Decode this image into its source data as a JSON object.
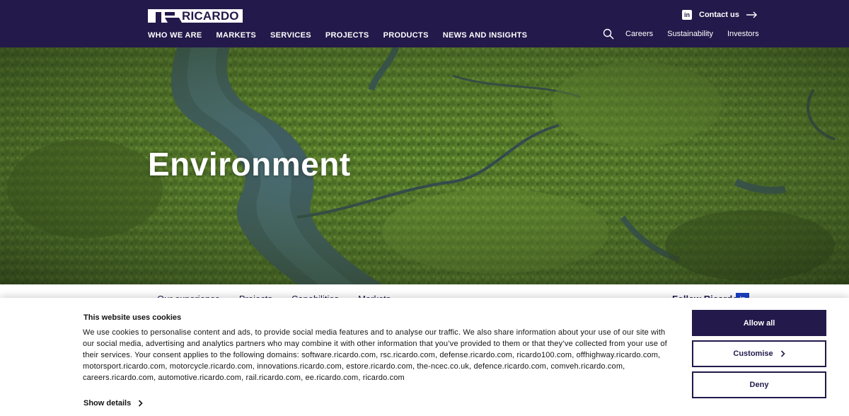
{
  "header": {
    "logo_text": "RICARDO",
    "nav": [
      "WHO WE ARE",
      "MARKETS",
      "SERVICES",
      "PROJECTS",
      "PRODUCTS",
      "NEWS AND INSIGHTS"
    ],
    "contact_label": "Contact us",
    "linkedin_icon_glyph": "in",
    "utility_links": [
      "Careers",
      "Sustainability",
      "Investors"
    ]
  },
  "hero": {
    "title": "Environment"
  },
  "subnav": {
    "items": [
      "Our experience",
      "Projects",
      "Capabilities",
      "Markets"
    ],
    "follow_label": "Follow Ricardo"
  },
  "cookie": {
    "title": "This website uses cookies",
    "body": "We use cookies to personalise content and ads, to provide social media features and to analyse our traffic. We also share information about your use of our site with our social media, advertising and analytics partners who may combine it with other information that you’ve provided to them or that they’ve collected from your use of their services. Your consent applies to the following domains: software.ricardo.com, rsc.ricardo.com, defense.ricardo.com, ricardo100.com, offhighway.ricardo.com, motorsport.ricardo.com, motorcycle.ricardo.com, innovations.ricardo.com, estore.ricardo.com, the-ncec.co.uk, defence.ricardo.com, comveh.ricardo.com, careers.ricardo.com, automotive.ricardo.com, rail.ricardo.com, ee.ricardo.com, ricardo.com",
    "show_details": "Show details",
    "allow_all": "Allow all",
    "customise": "Customise",
    "deny": "Deny"
  },
  "colors": {
    "brand_navy": "#23194a",
    "hero_green": "#4a6b26",
    "river_blue": "#3d5a6e"
  }
}
